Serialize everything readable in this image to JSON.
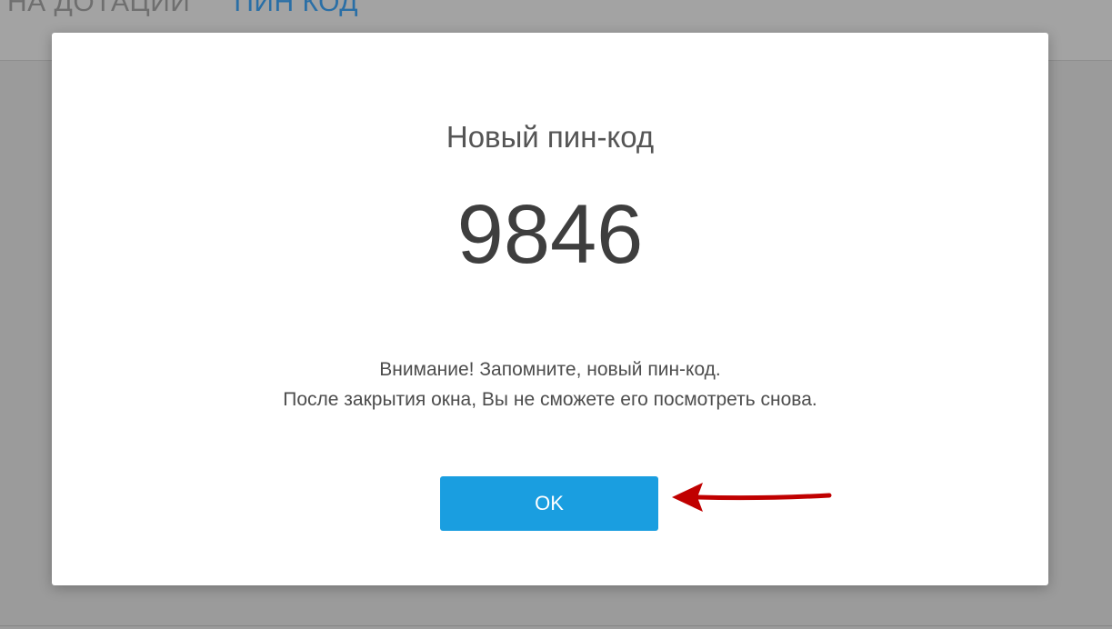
{
  "background_tabs": [
    {
      "label": "НА ДОТАЦИИ"
    },
    {
      "label": "ПИН КОД"
    }
  ],
  "dialog": {
    "title": "Новый пин-код",
    "pin": "9846",
    "warning_line1": "Внимание! Запомните, новый пин-код.",
    "warning_line2": "После закрытия окна, Вы не сможете его посмотреть снова.",
    "ok_label": "OK"
  },
  "annotation": {
    "arrow_color": "#c00000"
  },
  "colors": {
    "ok_button": "#1a9ee0",
    "active_tab": "#2a6fa6"
  }
}
